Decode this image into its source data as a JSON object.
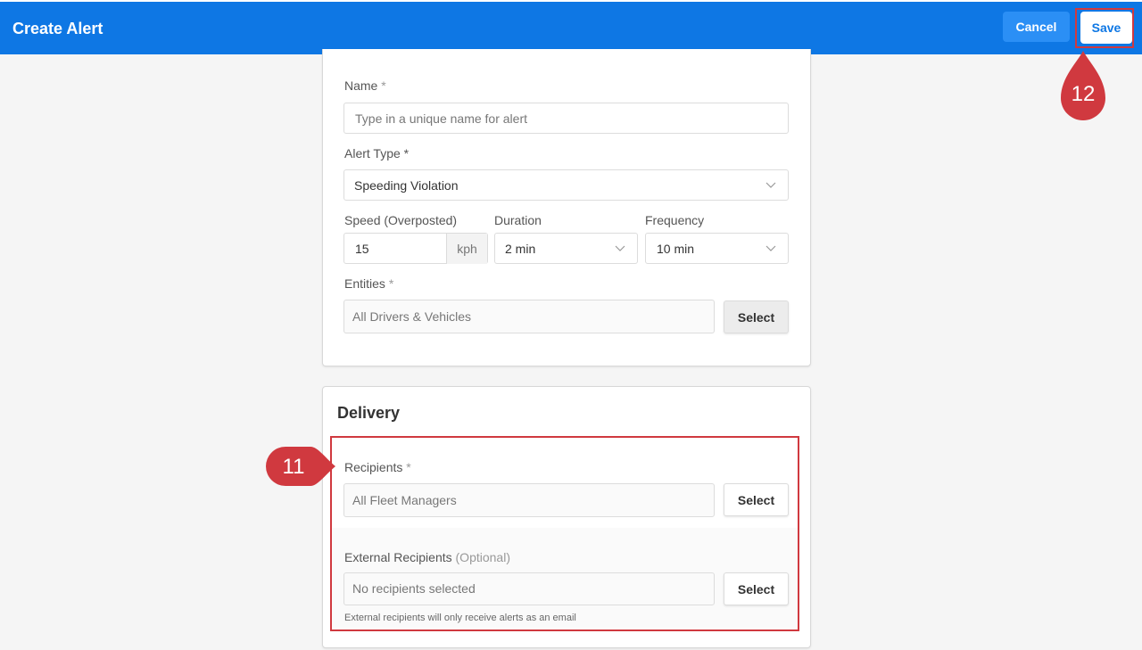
{
  "header": {
    "title": "Create Alert",
    "cancel_label": "Cancel",
    "save_label": "Save"
  },
  "form": {
    "name_label": "Name",
    "name_required": "*",
    "name_placeholder": "Type in a unique name for alert",
    "alert_type_label": "Alert Type",
    "alert_type_required": "*",
    "alert_type_value": "Speeding Violation",
    "speed_label": "Speed (Overposted)",
    "speed_value": "15",
    "speed_unit": "kph",
    "duration_label": "Duration",
    "duration_value": "2 min",
    "frequency_label": "Frequency",
    "frequency_value": "10 min",
    "entities_label": "Entities",
    "entities_required": "*",
    "entities_value": "All Drivers & Vehicles",
    "entities_select": "Select"
  },
  "delivery": {
    "title": "Delivery",
    "recipients_label": "Recipients",
    "recipients_required": "*",
    "recipients_value": "All Fleet Managers",
    "recipients_select": "Select",
    "external_label": "External Recipients",
    "external_optional": "(Optional)",
    "external_value": "No recipients selected",
    "external_select": "Select",
    "external_hint": "External recipients will only receive alerts as an email"
  },
  "annotations": {
    "marker_11": "11",
    "marker_12": "12",
    "accent_color": "#d0393f"
  },
  "colors": {
    "header_bg": "#0e77e4",
    "cancel_bg": "#2b8ff5"
  }
}
